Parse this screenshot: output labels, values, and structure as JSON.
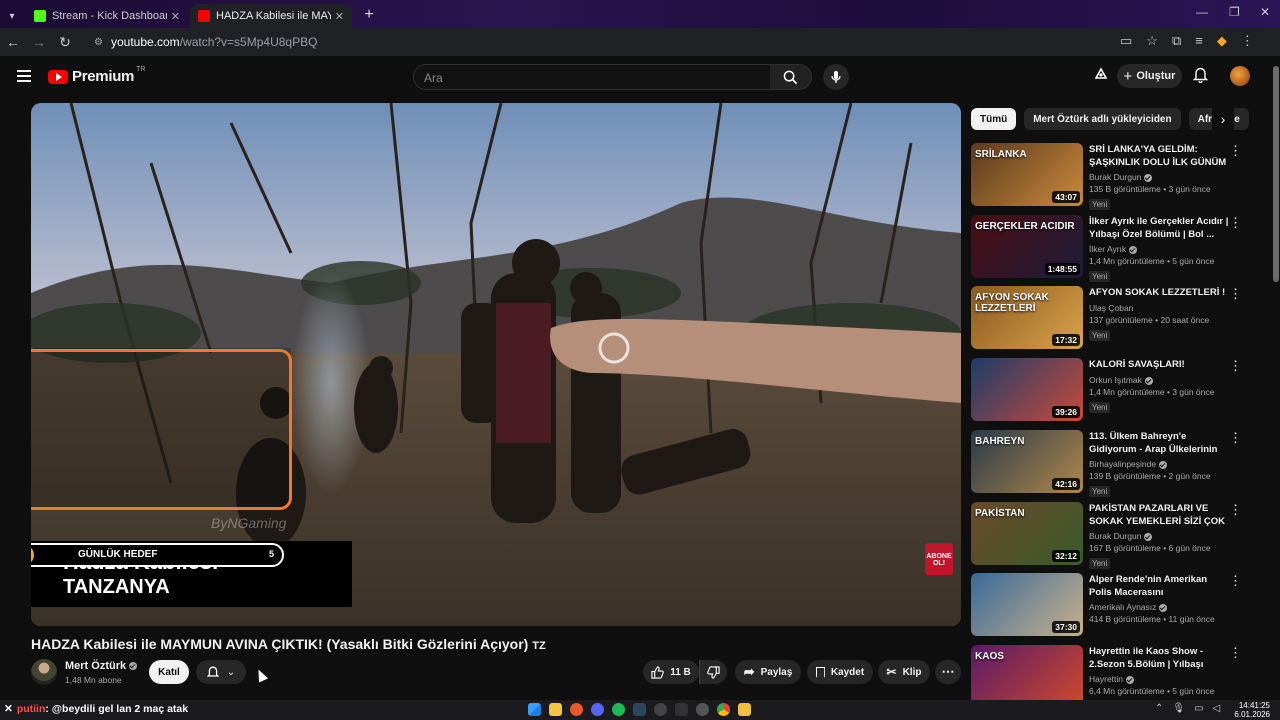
{
  "browser": {
    "tabs": [
      {
        "title": "Stream - Kick Dashboard -",
        "favicon_color": "#53fc18",
        "active": false
      },
      {
        "title": "HADZA Kabilesi ile MAYMUN AV",
        "favicon_color": "#ff0000",
        "active": true
      }
    ],
    "url_host": "youtube.com",
    "url_path": "/watch?v=s5Mp4U8qPBQ"
  },
  "youtube": {
    "logo": "Premium",
    "logo_suffix": "TR",
    "search_placeholder": "Ara",
    "create_label": "Oluştur"
  },
  "video": {
    "overlay_goal_label": "GÜNLÜK HEDEF",
    "overlay_goal_left": "1",
    "overlay_goal_right": "5",
    "overlay_title_line1": "Hadza Kabilesi",
    "overlay_title_line2": "TANZANYA",
    "watermark": "ByNGaming",
    "subscribe_line1": "ABONE",
    "subscribe_line2": "OL!",
    "title": "HADZA Kabilesi ile MAYMUN AVINA ÇIKTIK! (Yasaklı Bitki Gözlerini Açıyor)",
    "title_suffix": "TZ",
    "channel_name": "Mert Öztürk",
    "channel_subs": "1,48 Mn abone",
    "join_label": "Katıl",
    "likes": "11 B",
    "share_label": "Paylaş",
    "save_label": "Kaydet",
    "clip_label": "Klip"
  },
  "chips": [
    "Tümü",
    "Mert Öztürk adlı yükleyiciden",
    "Afrika se"
  ],
  "recommendations": [
    {
      "title": "SRİ LANKA'YA GELDİM: ŞAŞKINLIK DOLU İLK GÜNÜM",
      "title_suffix": "LK",
      "channel": "Burak Durgun",
      "verified": true,
      "meta": "135 B görüntüleme • 3 gün önce",
      "badge": "Yeni",
      "duration": "43:07",
      "thumb_text": "SRİLANKA",
      "thumb_colors": [
        "#5b3a20",
        "#c98a3a"
      ]
    },
    {
      "title": "İlker Ayrık ile Gerçekler Acıdır | Yılbaşı Özel Bölümü | Bol ...",
      "title_suffix": "",
      "channel": "İlker Ayrık",
      "verified": true,
      "meta": "1,4 Mn görüntüleme • 5 gün önce",
      "badge": "Yeni",
      "duration": "1:48:55",
      "thumb_text": "GERÇEKLER ACIDIR",
      "thumb_colors": [
        "#4a0d12",
        "#1c1c3a"
      ]
    },
    {
      "title": "AFYON SOKAK LEZZETLERİ !",
      "title_suffix": "",
      "channel": "Ulaş Çoban",
      "verified": false,
      "meta": "137 görüntüleme • 20 saat önce",
      "badge": "Yeni",
      "duration": "17:32",
      "thumb_text": "AFYON SOKAK LEZZETLERİ",
      "thumb_colors": [
        "#8a5a20",
        "#d9a44a"
      ]
    },
    {
      "title": "KALORİ SAVAŞLARI!",
      "title_suffix": "",
      "channel": "Orkun Işıtmak",
      "verified": true,
      "meta": "1,4 Mn görüntüleme • 3 gün önce",
      "badge": "Yeni",
      "duration": "39:26",
      "thumb_text": "",
      "thumb_colors": [
        "#1d3d6b",
        "#c84a3a"
      ]
    },
    {
      "title": "113. Ülkem Bahreyn'e Gidiyorum - Arap Ülkelerinin L...",
      "title_suffix": "",
      "channel": "Birhayalinpeşinde",
      "verified": true,
      "meta": "139 B görüntüleme • 2 gün önce",
      "badge": "Yeni",
      "duration": "42:16",
      "thumb_text": "BAHREYN",
      "thumb_colors": [
        "#2a3a4a",
        "#b0884a"
      ]
    },
    {
      "title": "PAKİSTAN PAZARLARI VE SOKAK YEMEKLERİ SİZİ ÇOK ...",
      "title_suffix": "",
      "channel": "Burak Durgun",
      "verified": true,
      "meta": "167 B görüntüleme • 6 gün önce",
      "badge": "Yeni",
      "duration": "32:12",
      "thumb_text": "PAKİSTAN",
      "thumb_colors": [
        "#6a4a2a",
        "#3a5a2a"
      ]
    },
    {
      "title": "Alper Rende'nin Amerikan Polis Macerasını Yorumluyoruum! ...",
      "title_suffix": "",
      "channel": "Amerikalı Aynasız",
      "verified": true,
      "meta": "414 B görüntüleme • 11 gün önce",
      "badge": "",
      "duration": "37:30",
      "thumb_text": "",
      "thumb_colors": [
        "#3a6a9a",
        "#c8b08a"
      ]
    },
    {
      "title": "Hayrettin ile Kaos Show - 2.Sezon 5.Bölüm | Yılbaşı Özel...",
      "title_suffix": "",
      "channel": "Hayrettin",
      "verified": true,
      "meta": "6,4 Mn görüntüleme • 5 gün önce",
      "badge": "",
      "duration": "",
      "thumb_text": "KAOS",
      "thumb_colors": [
        "#5a1a6a",
        "#d04a2a"
      ]
    }
  ],
  "taskbar": {
    "chat_user": "putiin",
    "chat_message": ": @beydili gel lan 2 maç atak",
    "time": "14:41:25",
    "date": "6.01.2026"
  },
  "colors": {
    "overlay_border": "#f07a2a",
    "youtube_red": "#ff0000",
    "kick_green": "#53fc18",
    "goal_bar": "#f5a623"
  },
  "goal_progress": 0.1
}
